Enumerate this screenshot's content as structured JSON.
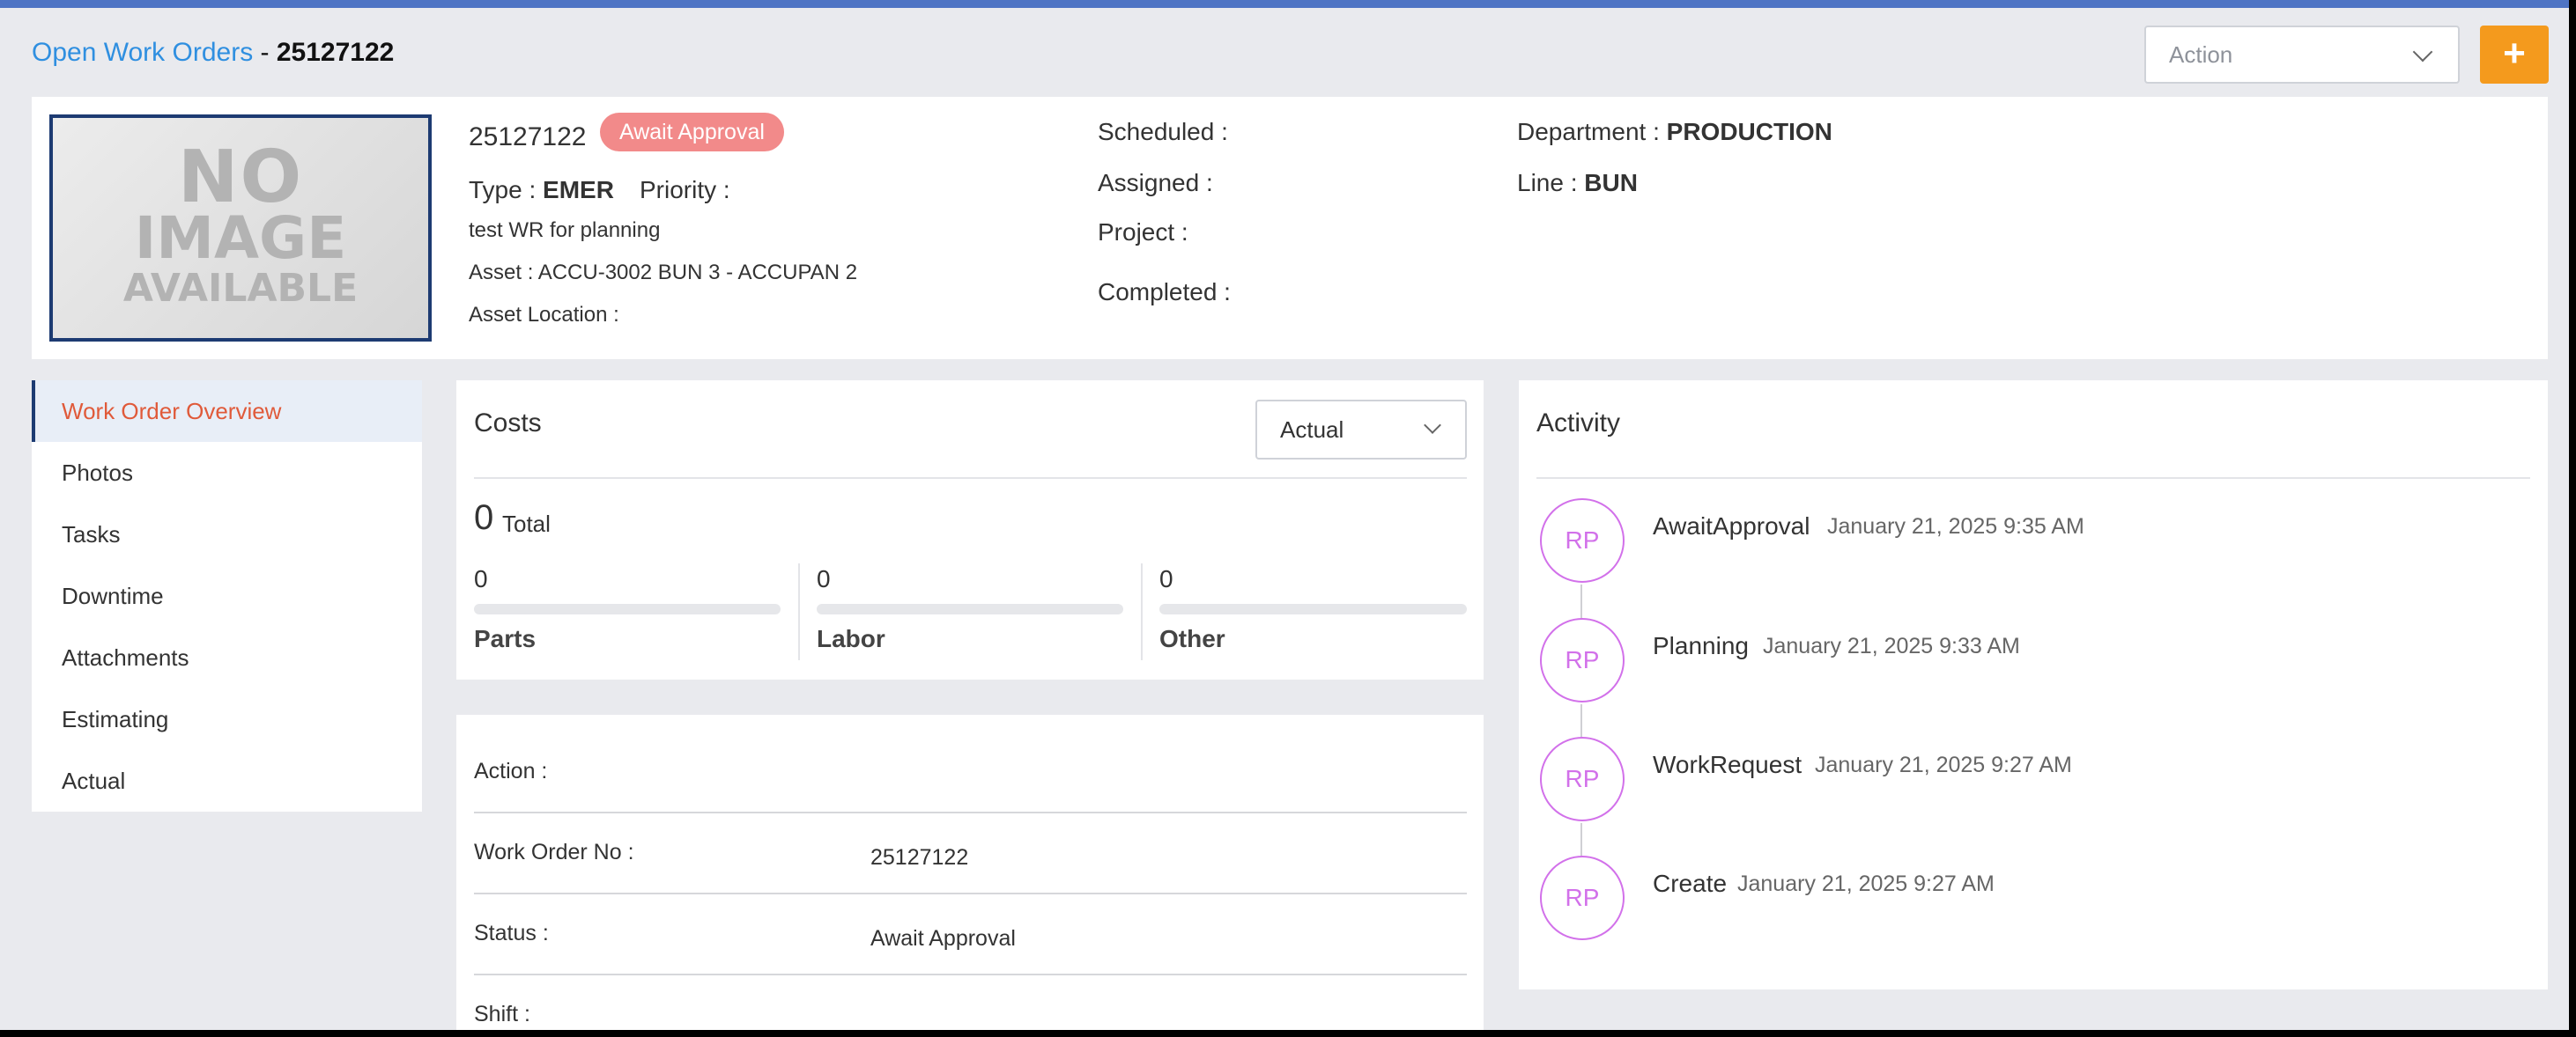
{
  "header": {
    "breadcrumb_link": "Open Work Orders",
    "breadcrumb_sep": " - ",
    "work_order_number": "25127122",
    "action_placeholder": "Action",
    "add_label": "+"
  },
  "image_placeholder": {
    "line1": "NO",
    "line2": "IMAGE",
    "line3": "AVAILABLE"
  },
  "work_order": {
    "number": "25127122",
    "status_badge": "Await Approval",
    "type_label": "Type :",
    "type_value": "EMER",
    "priority_label": "Priority :",
    "description": "test WR for planning",
    "asset": "Asset : ACCU-3002 BUN 3 - ACCUPAN 2",
    "asset_location": "Asset Location :",
    "scheduled_label": "Scheduled :",
    "assigned_label": "Assigned :",
    "project_label": "Project :",
    "completed_label": "Completed :",
    "department_label": "Department :",
    "department_value": "PRODUCTION",
    "line_label": "Line :",
    "line_value": "BUN",
    "badge_color": "#f28a8a"
  },
  "sidebar": {
    "items": [
      {
        "label": "Work Order Overview",
        "active": true
      },
      {
        "label": "Photos"
      },
      {
        "label": "Tasks"
      },
      {
        "label": "Downtime"
      },
      {
        "label": "Attachments"
      },
      {
        "label": "Estimating"
      },
      {
        "label": "Actual"
      }
    ]
  },
  "costs": {
    "title": "Costs",
    "mode": "Actual",
    "total_value": "0",
    "total_label": "Total",
    "columns": [
      {
        "value": "0",
        "label": "Parts"
      },
      {
        "value": "0",
        "label": "Labor"
      },
      {
        "value": "0",
        "label": "Other"
      }
    ]
  },
  "details": {
    "rows": [
      {
        "label": "Action :",
        "value": ""
      },
      {
        "label": "Work Order No :",
        "value": "25127122"
      },
      {
        "label": "Status :",
        "value": "Await Approval"
      },
      {
        "label": "Shift :",
        "value": ""
      }
    ]
  },
  "activity": {
    "title": "Activity",
    "items": [
      {
        "initials": "RP",
        "event": "AwaitApproval",
        "time": "January 21, 2025 9:35 AM"
      },
      {
        "initials": "RP",
        "event": "Planning",
        "time": "January 21, 2025 9:33 AM"
      },
      {
        "initials": "RP",
        "event": "WorkRequest",
        "time": "January 21, 2025 9:27 AM"
      },
      {
        "initials": "RP",
        "event": "Create",
        "time": "January 21, 2025 9:27 AM"
      }
    ],
    "avatar_color": "#d271ea"
  },
  "colors": {
    "accent_link": "#2f8fe0",
    "add_button": "#f49a1d",
    "active_nav_text": "#e05a3a",
    "top_bar": "#4e74c4"
  }
}
